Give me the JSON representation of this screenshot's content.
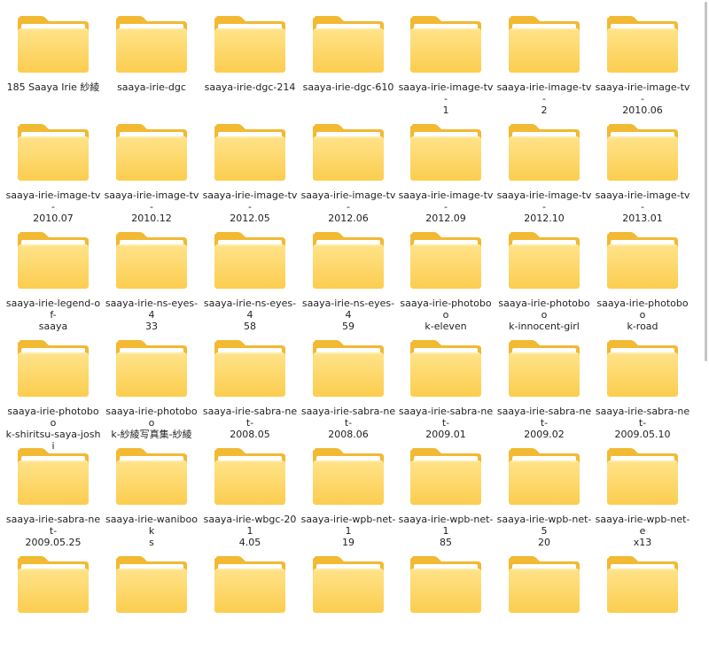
{
  "colors": {
    "folder_back": "#F2B932",
    "folder_front_top": "#FFE38A",
    "folder_front_bottom": "#FCCD4F",
    "folder_paper": "#FFFFFF"
  },
  "folders": [
    {
      "label": "185 Saaya Irie 紗綾"
    },
    {
      "label": "saaya-irie-dgc"
    },
    {
      "label": "saaya-irie-dgc-214"
    },
    {
      "label": "saaya-irie-dgc-610"
    },
    {
      "label": "saaya-irie-image-tv-\n1"
    },
    {
      "label": "saaya-irie-image-tv-\n2"
    },
    {
      "label": "saaya-irie-image-tv-\n2010.06"
    },
    {
      "label": "saaya-irie-image-tv-\n2010.07"
    },
    {
      "label": "saaya-irie-image-tv-\n2010.12"
    },
    {
      "label": "saaya-irie-image-tv-\n2012.05"
    },
    {
      "label": "saaya-irie-image-tv-\n2012.06"
    },
    {
      "label": "saaya-irie-image-tv-\n2012.09"
    },
    {
      "label": "saaya-irie-image-tv-\n2012.10"
    },
    {
      "label": "saaya-irie-image-tv-\n2013.01"
    },
    {
      "label": "saaya-irie-legend-of-\nsaaya"
    },
    {
      "label": "saaya-irie-ns-eyes-4\n33"
    },
    {
      "label": "saaya-irie-ns-eyes-4\n58"
    },
    {
      "label": "saaya-irie-ns-eyes-4\n59"
    },
    {
      "label": "saaya-irie-photoboo\nk-eleven"
    },
    {
      "label": "saaya-irie-photoboo\nk-innocent-girl"
    },
    {
      "label": "saaya-irie-photoboo\nk-road"
    },
    {
      "label": "saaya-irie-photoboo\nk-shiritsu-saya-joshi"
    },
    {
      "label": "saaya-irie-photoboo\nk-紗綾写真集-紗綾"
    },
    {
      "label": "saaya-irie-sabra-net-\n2008.05"
    },
    {
      "label": "saaya-irie-sabra-net-\n2008.06"
    },
    {
      "label": "saaya-irie-sabra-net-\n2009.01"
    },
    {
      "label": "saaya-irie-sabra-net-\n2009.02"
    },
    {
      "label": "saaya-irie-sabra-net-\n2009.05.10"
    },
    {
      "label": "saaya-irie-sabra-net-\n2009.05.25"
    },
    {
      "label": "saaya-irie-wanibook\ns"
    },
    {
      "label": "saaya-irie-wbgc-201\n4.05"
    },
    {
      "label": "saaya-irie-wpb-net-1\n19"
    },
    {
      "label": "saaya-irie-wpb-net-1\n85"
    },
    {
      "label": "saaya-irie-wpb-net-5\n20"
    },
    {
      "label": "saaya-irie-wpb-net-e\nx13"
    },
    {
      "label": ""
    },
    {
      "label": ""
    },
    {
      "label": ""
    },
    {
      "label": ""
    },
    {
      "label": ""
    },
    {
      "label": ""
    },
    {
      "label": ""
    }
  ]
}
